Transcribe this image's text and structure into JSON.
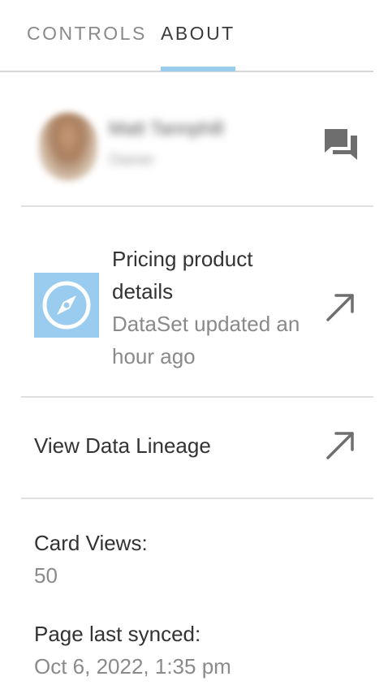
{
  "tabs": {
    "controls": "CONTROLS",
    "about": "ABOUT",
    "active": "about"
  },
  "owner": {
    "name": "Matt Tannphill",
    "role": "Owner",
    "chat_icon": "chat-bubbles-icon"
  },
  "dataset": {
    "title": "Pricing product details",
    "subtitle": "DataSet updated an hour ago",
    "thumb_icon": "compass-icon",
    "open_icon": "external-arrow-icon"
  },
  "lineage": {
    "label": "View Data Lineage",
    "open_icon": "external-arrow-icon"
  },
  "stats": {
    "views_label": "Card Views:",
    "views_value": "50",
    "synced_label": "Page last synced:",
    "synced_value": "Oct 6, 2022, 1:35 pm"
  },
  "colors": {
    "accent": "#99ccee",
    "text": "#333333",
    "muted": "#8a8a8a",
    "icon": "#6e6e6e",
    "divider": "#e0e0e0"
  }
}
